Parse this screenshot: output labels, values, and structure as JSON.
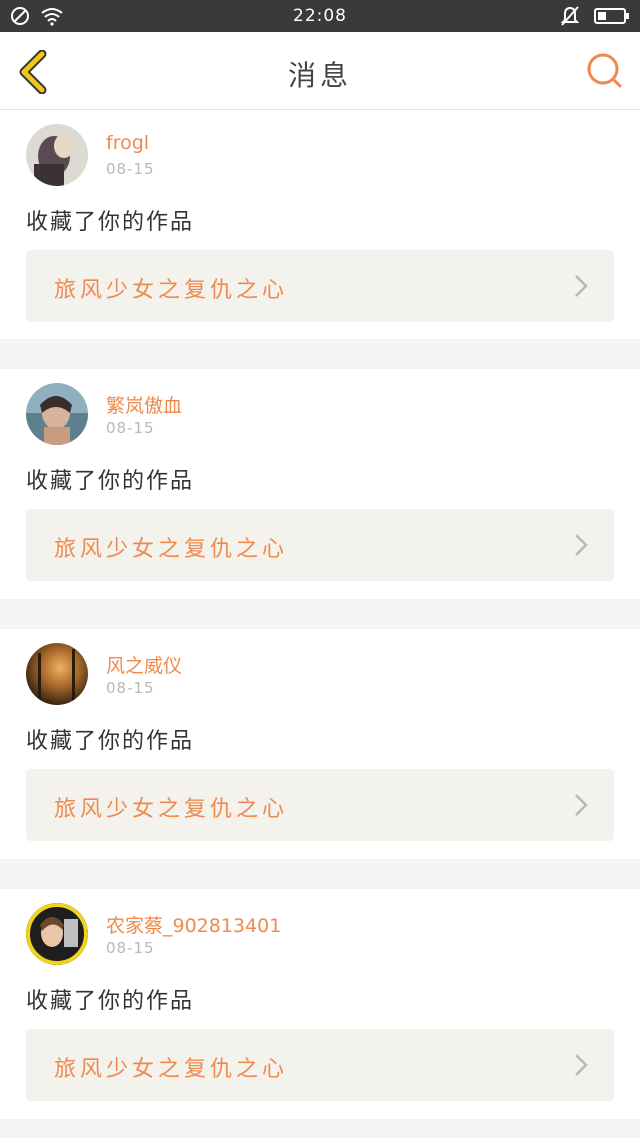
{
  "status_bar": {
    "time": "22:08"
  },
  "header": {
    "title": "消息"
  },
  "colors": {
    "accent": "#ef8a4f",
    "back_arrow": "#f5c518",
    "work_bg": "#f3f2ec"
  },
  "messages": [
    {
      "username": "frogl",
      "date": "08-15",
      "action": "收藏了你的作品",
      "work_title": "旅风少女之复仇之心"
    },
    {
      "username": "繁岚傲血",
      "date": "08-15",
      "action": "收藏了你的作品",
      "work_title": "旅风少女之复仇之心"
    },
    {
      "username": "风之威仪",
      "date": "08-15",
      "action": "收藏了你的作品",
      "work_title": "旅风少女之复仇之心"
    },
    {
      "username": "农家蔡_902813401",
      "date": "08-15",
      "action": "收藏了你的作品",
      "work_title": "旅风少女之复仇之心"
    }
  ]
}
